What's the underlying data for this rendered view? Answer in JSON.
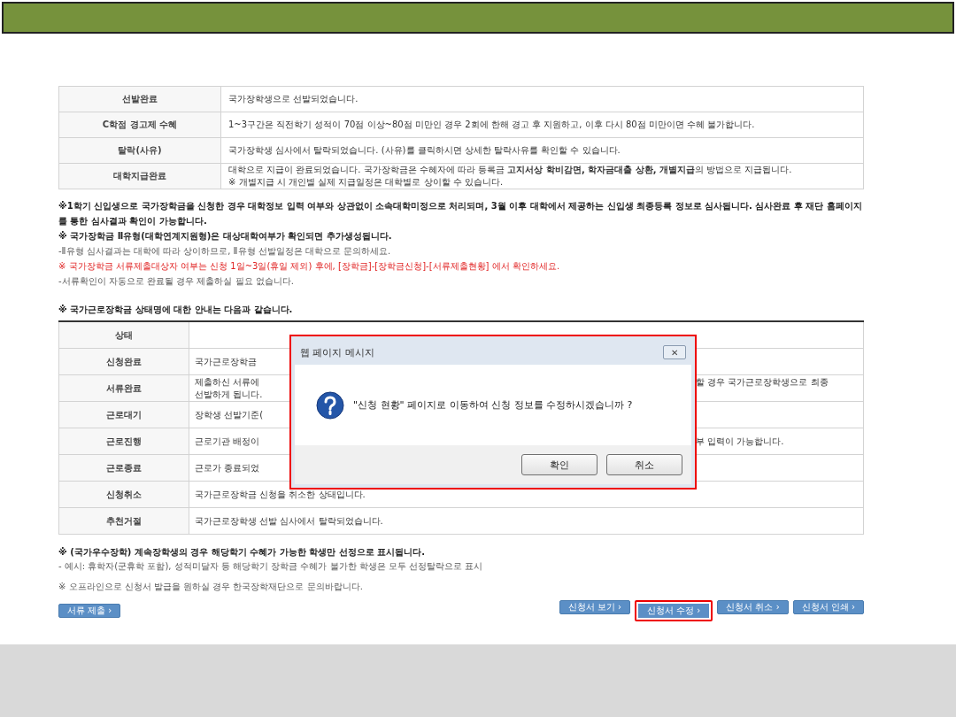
{
  "status_table": {
    "rows": [
      {
        "status": "선발완료",
        "lines": [
          "국가장학생으로 선발되었습니다."
        ]
      },
      {
        "status": "C학점 경고제 수혜",
        "lines": [
          "1~3구간은 직전학기 성적이 70점 이상~80점 미만인 경우 2회에 한해 경고 후 지원하고, 이후 다시 80점 미만이면 수혜 불가합니다."
        ]
      },
      {
        "status": "탈락(사유)",
        "lines": [
          "국가장학생 심사에서 탈락되었습니다. (사유)를 클릭하시면 상세한 탈락사유를 확인할 수 있습니다."
        ]
      },
      {
        "status": "대학지급완료",
        "lines": [
          "대학으로 지급이 완료되었습니다. 국가장학금은 수혜자에 따라 등록금 **고지서상 학비감면, 학자금대출 상환, 개별지급**의 방법으로 지급됩니다.",
          "※ 개별지급 시 개인별 실제 지급일정은 대학별로 상이할 수 있습니다."
        ]
      }
    ]
  },
  "notes": [
    {
      "kind": "bold",
      "text": "※1학기 신입생으로 국가장학금을 신청한 경우 대학정보 입력 여부와 상관없이 소속대학미정으로 처리되며, 3월 이후 대학에서 제공하는 신입생 최종등록 정보로 심사됩니다. 심사완료 후 재단 홈페이지를 통한 심사결과 확인이 가능합니다."
    },
    {
      "kind": "bold",
      "text": "※ 국가장학금 Ⅱ유형(대학연계지원형)은 대상대학여부가 확인되면 추가생성됩니다."
    },
    {
      "kind": "plain",
      "text": "-Ⅱ유형 심사결과는 대학에 따라 상이하므로, Ⅱ유형 선발일정은 대학으로 문의하세요."
    },
    {
      "kind": "alert",
      "text": "※ 국가장학금 서류제출대상자 여부는 신청 1일~3일(휴일 제외) 후에, [장학금]-[장학금신청]-[서류제출현황] 에서 확인하세요."
    },
    {
      "kind": "plain",
      "text": "-서류확인이 자동으로 완료될 경우 제출하실 필요 없습니다."
    }
  ],
  "work_heading": "※ 국가근로장학금 상태명에 대한 안내는 다음과 같습니다.",
  "work_table": {
    "header": "상태",
    "rows": [
      {
        "status": "신청완료",
        "left": [
          "국가근로장학금"
        ]
      },
      {
        "status": "서류완료",
        "left": [
          "제출하신 서류에",
          "선발하게 됩니다."
        ],
        "right": "할 경우 국가근로장학생으로 최종"
      },
      {
        "status": "근로대기",
        "left": [
          "장학생 선발기준("
        ]
      },
      {
        "status": "근로진행",
        "left": [
          "근로기관 배정이"
        ],
        "right": "부 입력이 가능합니다."
      },
      {
        "status": "근로종료",
        "left": [
          "근로가 종료되었"
        ]
      },
      {
        "status": "신청취소",
        "left": [
          "국가근로장학금 신청을 취소한 상태입니다."
        ]
      },
      {
        "status": "추천거절",
        "left": [
          "국가근로장학생 선발 심사에서 탈락되었습니다."
        ]
      }
    ]
  },
  "footnotes": [
    {
      "kind": "bold",
      "text": "※ (국가우수장학) 계속장학생의 경우 해당학기 수혜가 가능한 학생만 선정으로 표시됩니다."
    },
    {
      "kind": "plain",
      "text": "- 예시: 휴학자(군휴학 포함), 성적미달자 등 해당학기 장학금 수혜가 불가한 학생은 모두 선정탈락으로 표시"
    },
    {
      "kind": "gap",
      "text": "※ 오프라인으로 신청서 발급을 원하실 경우 한국장학재단으로 문의바랍니다."
    }
  ],
  "left_button": {
    "label": "서류 제출 ›",
    "highlighted": false
  },
  "right_buttons": [
    {
      "label": "신청서 보기 ›",
      "highlighted": false
    },
    {
      "label": "신청서 수정 ›",
      "highlighted": true
    },
    {
      "label": "신청서 취소 ›",
      "highlighted": false
    },
    {
      "label": "신청서 인쇄 ›",
      "highlighted": false
    }
  ],
  "dialog": {
    "title": "웹 페이지 메시지",
    "close": "✕",
    "message": "\"신청 현황\" 페이지로 이동하여 신청 정보를 수정하시겠습니까 ?",
    "buttons": [
      "확인",
      "취소"
    ],
    "highlighted": true
  }
}
